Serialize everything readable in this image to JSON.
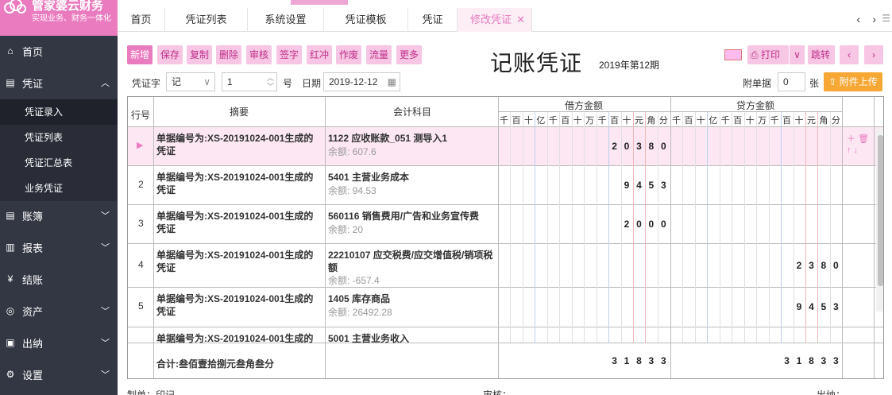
{
  "logo": {
    "title": "管家婆云财务",
    "subtitle": "实现业务、财务一体化"
  },
  "nav": [
    {
      "label": "首页",
      "icon": "home-icon"
    },
    {
      "label": "凭证",
      "icon": "voucher-icon",
      "sub": [
        "凭证录入",
        "凭证列表",
        "凭证汇总表",
        "业务凭证"
      ]
    },
    {
      "label": "账簿",
      "icon": "book-icon"
    },
    {
      "label": "报表",
      "icon": "chart-icon"
    },
    {
      "label": "结账",
      "icon": "yen-icon"
    },
    {
      "label": "资产",
      "icon": "asset-icon"
    },
    {
      "label": "出纳",
      "icon": "cashier-icon"
    },
    {
      "label": "设置",
      "icon": "settings-icon"
    }
  ],
  "tabs": [
    "首页",
    "凭证列表",
    "系统设置",
    "凭证模板",
    "凭证",
    "修改凭证"
  ],
  "toolbar": [
    "新增",
    "保存",
    "复制",
    "删除",
    "审核",
    "签字",
    "红冲",
    "作废",
    "流量",
    "更多"
  ],
  "title": "记账凭证",
  "period": "2019年第12期",
  "right_buttons": {
    "print": "打印",
    "jump": "跳转"
  },
  "form": {
    "word_label": "凭证字",
    "word": "记",
    "num": "1",
    "num_suffix": "号",
    "date_label": "日期",
    "date": "2019-12-12",
    "attach_label": "附单据",
    "attach": "0",
    "attach_unit": "张",
    "upload": "附件上传"
  },
  "headers": {
    "row": "行号",
    "summary": "摘要",
    "account": "会计科目",
    "debit": "借方金额",
    "credit": "贷方金额",
    "units": [
      "千",
      "百",
      "十",
      "亿",
      "千",
      "百",
      "十",
      "万",
      "千",
      "百",
      "十",
      "元",
      "角",
      "分"
    ]
  },
  "rows": [
    {
      "no": "▶",
      "summary": "单据编号为:XS-20191024-001生成的凭证",
      "account": "1122 应收账款_051 测导入1",
      "balance": "余额: 607.6",
      "debit": "20380",
      "credit": ""
    },
    {
      "no": "2",
      "summary": "单据编号为:XS-20191024-001生成的凭证",
      "account": "5401 主营业务成本",
      "balance": "余额: 94.53",
      "debit": "9453",
      "credit": ""
    },
    {
      "no": "3",
      "summary": "单据编号为:XS-20191024-001生成的凭证",
      "account": "560116 销售费用/广告和业务宣传费",
      "balance": "余额: 20",
      "debit": "2000",
      "credit": ""
    },
    {
      "no": "4",
      "summary": "单据编号为:XS-20191024-001生成的凭证",
      "account": "22210107 应交税费/应交增值税/销项税额",
      "balance": "余额: -657.4",
      "debit": "",
      "credit": "2380"
    },
    {
      "no": "5",
      "summary": "单据编号为:XS-20191024-001生成的凭证",
      "account": "1405 库存商品",
      "balance": "余额: 26492.28",
      "debit": "",
      "credit": "9453"
    },
    {
      "no": "",
      "summary": "单据编号为:XS-20191024-001生成的凭",
      "account": "5001 主营业务收入",
      "balance": "",
      "debit": "",
      "credit": ""
    }
  ],
  "total": {
    "label": "合计:叁佰壹拾捌元叁角叁分",
    "debit": "31833",
    "credit": "31833"
  },
  "footer": {
    "maker": "制单：印记",
    "auditor": "审核：",
    "cashier": "出纳："
  }
}
